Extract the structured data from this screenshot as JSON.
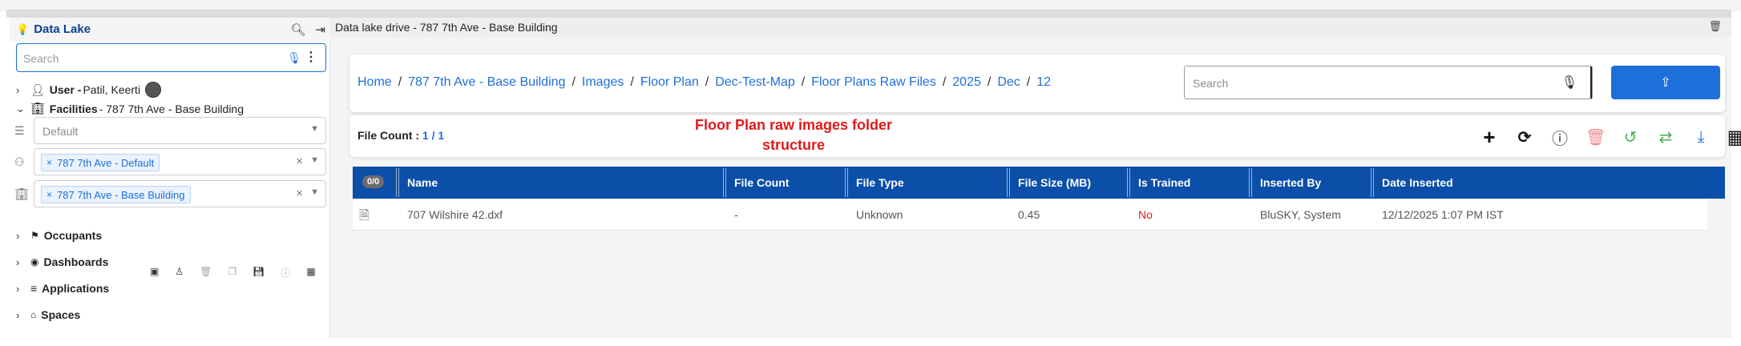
{
  "sidebar": {
    "title": "Data Lake",
    "search_placeholder": "Search",
    "user": {
      "label": "User - ",
      "name": "Patil, Keerti"
    },
    "facilities": {
      "label": "Facilities",
      "value": " - 787 7th Ave - Base Building"
    },
    "select_default_placeholder": "Default",
    "tag_floor": "787 7th Ave - Default",
    "tag_building": "787 7th Ave - Base Building",
    "sections": [
      "Occupants",
      "Dashboards",
      "Applications",
      "Spaces"
    ]
  },
  "main": {
    "title": "Data lake drive - 787 7th Ave - Base Building",
    "breadcrumbs": [
      "Home",
      "787 7th Ave - Base Building",
      "Images",
      "Floor Plan",
      "Dec-Test-Map",
      "Floor Plans Raw Files",
      "2025",
      "Dec",
      "12"
    ],
    "search_placeholder": "Search",
    "file_count_label": "File Count : ",
    "file_count_value": "1 / 1",
    "annotation_line1": "Floor Plan raw images folder",
    "annotation_line2": "structure",
    "selection_badge": "0/0",
    "columns": [
      "Name",
      "File Count",
      "File Type",
      "File Size (MB)",
      "Is Trained",
      "Inserted By",
      "Date Inserted"
    ],
    "rows": [
      {
        "name": "707 Wilshire 42.dxf",
        "file_count": "-",
        "file_type": "Unknown",
        "file_size": "0.45",
        "is_trained": "No",
        "inserted_by": "BluSKY, System",
        "date_inserted": "12/12/2025 1:07 PM IST"
      }
    ]
  },
  "colors": {
    "accent": "#1e6fd9",
    "header_blue": "#0b4fa8",
    "annotation_red": "#e01b1b"
  }
}
